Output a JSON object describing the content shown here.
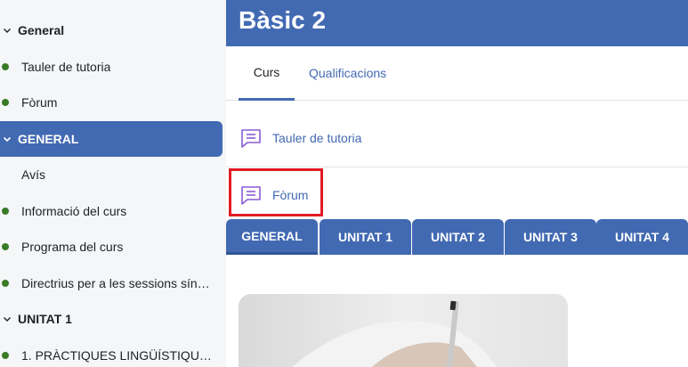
{
  "sidebar": {
    "items": [
      {
        "label": "General",
        "kind": "section"
      },
      {
        "label": "Tauler de tutoria",
        "kind": "activity"
      },
      {
        "label": "Fòrum",
        "kind": "activity"
      },
      {
        "label": "GENERAL",
        "kind": "section-active"
      },
      {
        "label": "Avís",
        "kind": "plain"
      },
      {
        "label": "Informació del curs",
        "kind": "activity"
      },
      {
        "label": "Programa del curs",
        "kind": "activity"
      },
      {
        "label": "Directrius per a les sessions sín…",
        "kind": "activity"
      },
      {
        "label": "UNITAT 1",
        "kind": "section"
      },
      {
        "label": "1. PRÀCTIQUES LINGÜÍSTIQU…",
        "kind": "activity"
      }
    ]
  },
  "header": {
    "title": "Bàsic 2"
  },
  "tabs": [
    {
      "label": "Curs"
    },
    {
      "label": "Qualificacions"
    }
  ],
  "activities": [
    {
      "label": "Tauler de tutoria",
      "icon": "forum-icon"
    },
    {
      "label": "Fòrum",
      "icon": "forum-icon"
    }
  ],
  "unit_tabs": [
    {
      "label": "GENERAL"
    },
    {
      "label": "UNITAT 1"
    },
    {
      "label": "UNITAT 2"
    },
    {
      "label": "UNITAT 3"
    },
    {
      "label": "UNITAT 4"
    }
  ],
  "colors": {
    "brand": "#426ab2",
    "dot": "#3a7a26",
    "highlight": "#e21b24",
    "forum_icon": "#8a5bd6"
  }
}
